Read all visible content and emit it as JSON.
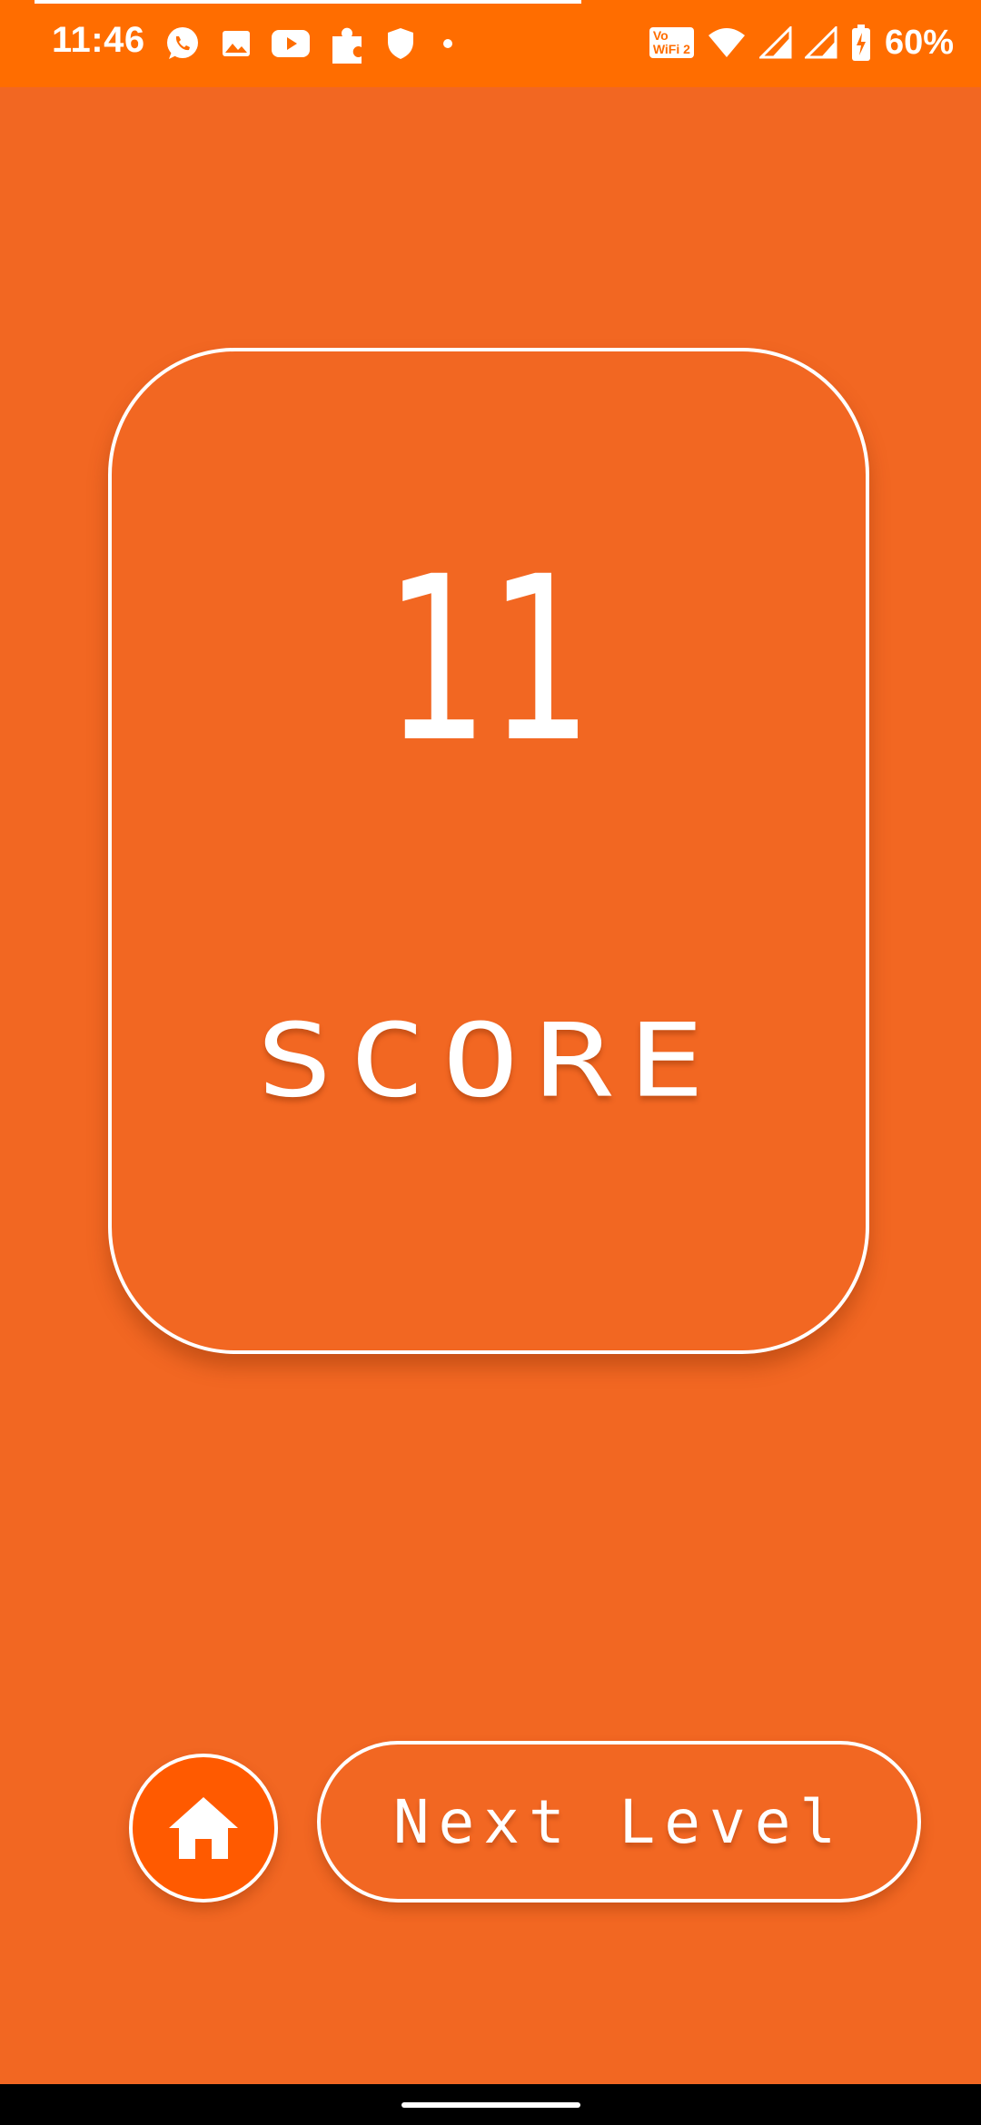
{
  "status_bar": {
    "time": "11:46",
    "vowifi_line1": "Vo",
    "vowifi_line2": "WiFi 2",
    "battery_percent": "60%",
    "left_icons": [
      "whatsapp-icon",
      "gallery-icon",
      "youtube-icon",
      "puzzle-icon",
      "shield-icon",
      "dot-icon"
    ],
    "right_icons": [
      "vowifi-icon",
      "wifi-icon",
      "signal-icon",
      "signal-icon",
      "battery-charging-icon"
    ]
  },
  "score_card": {
    "value": "11",
    "label": "SCORE"
  },
  "buttons": {
    "home_icon": "home-icon",
    "next_level_label": "Next Level"
  },
  "colors": {
    "background": "#F26722",
    "status_bar": "#FF6D00",
    "home_button": "#FF5A00",
    "text": "#FFFFFF"
  }
}
